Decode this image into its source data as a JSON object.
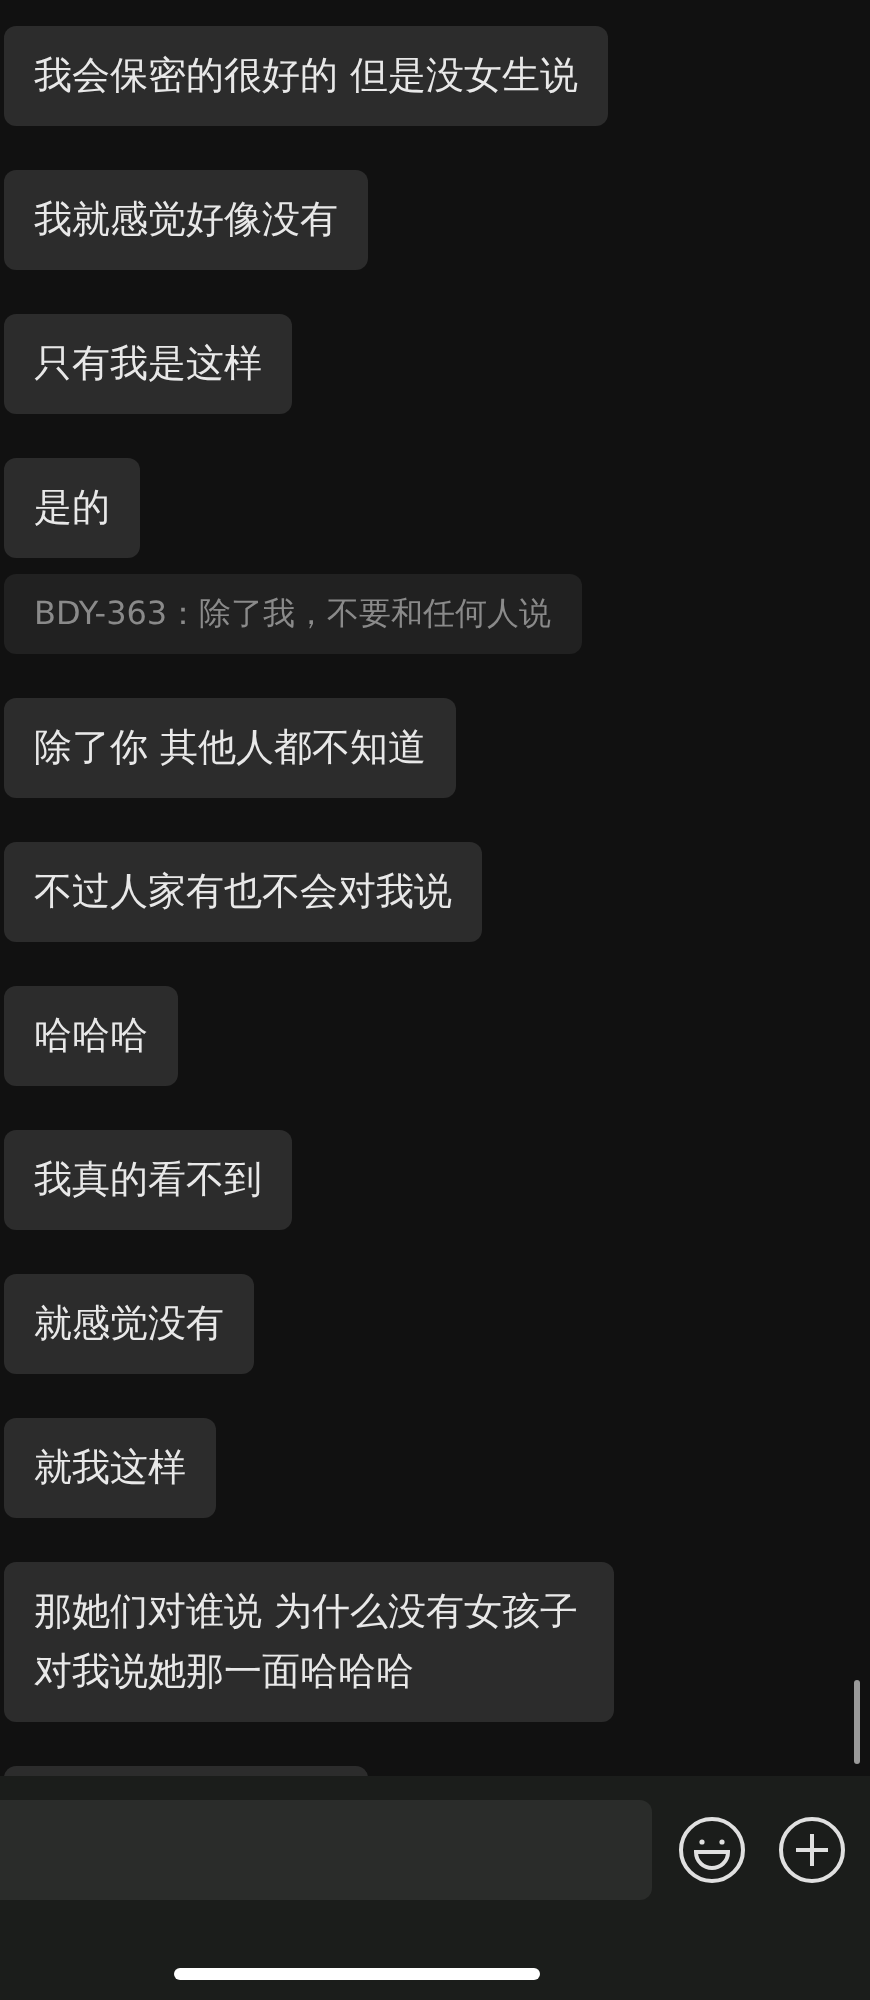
{
  "messages": [
    {
      "kind": "text",
      "text": "我会保密的很好的 但是没女生说"
    },
    {
      "kind": "text",
      "text": "我就感觉好像没有"
    },
    {
      "kind": "text",
      "text": "只有我是这样"
    },
    {
      "kind": "text",
      "text": "是的"
    },
    {
      "kind": "quote",
      "text": "BDY-363：除了我，不要和任何人说"
    },
    {
      "kind": "text",
      "text": "除了你 其他人都不知道"
    },
    {
      "kind": "text",
      "text": "不过人家有也不会对我说"
    },
    {
      "kind": "text",
      "text": "哈哈哈"
    },
    {
      "kind": "text",
      "text": "我真的看不到"
    },
    {
      "kind": "text",
      "text": "就感觉没有"
    },
    {
      "kind": "text",
      "text": "就我这样"
    },
    {
      "kind": "text",
      "text": "那她们对谁说 为什么没有女孩子对我说她那一面哈哈哈"
    },
    {
      "kind": "partial"
    }
  ]
}
